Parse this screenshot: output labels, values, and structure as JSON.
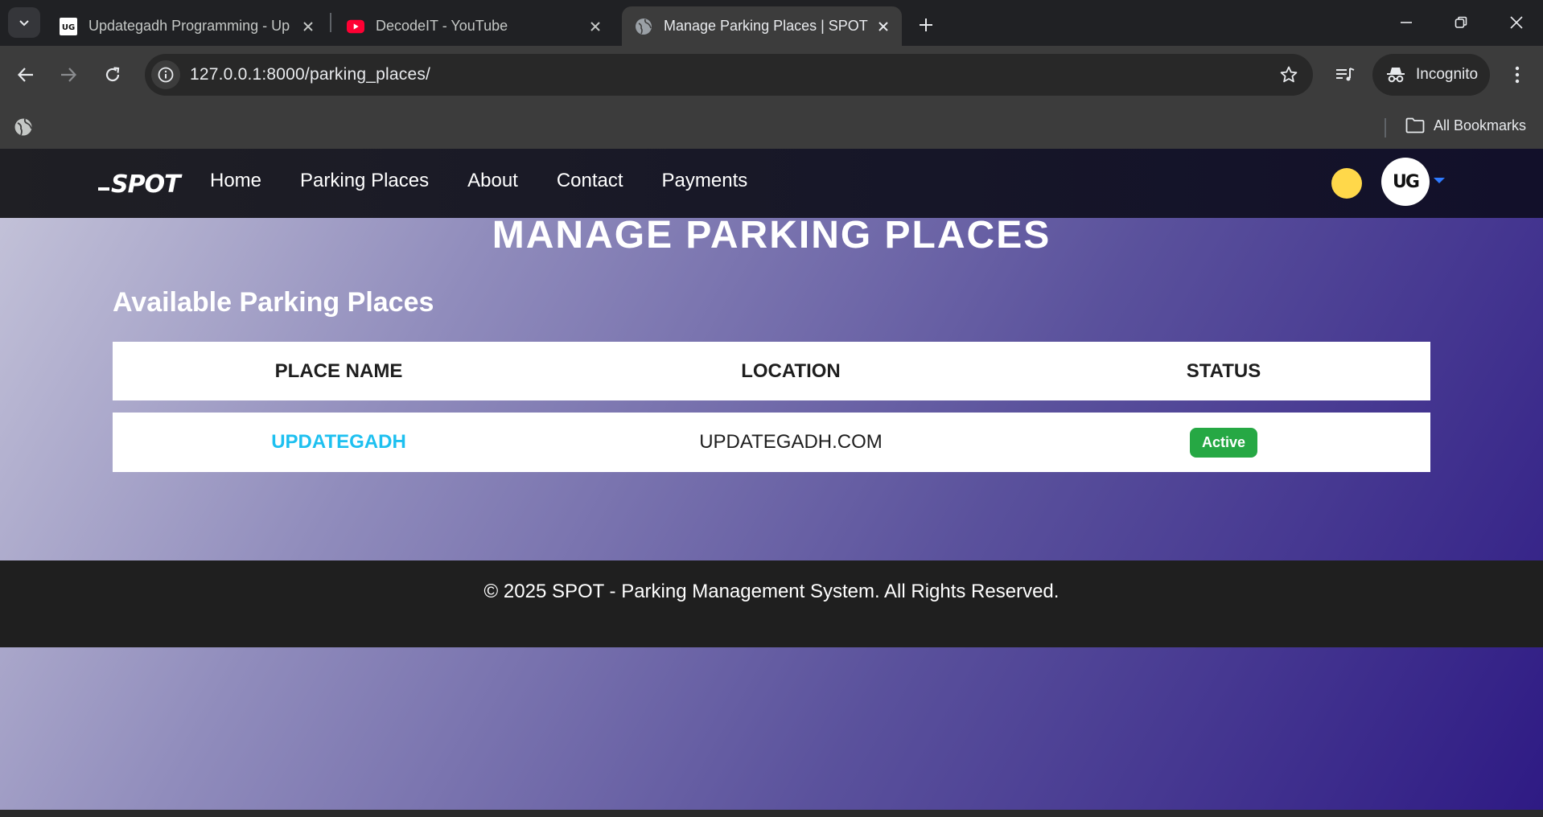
{
  "browser": {
    "tabs": [
      {
        "title": "Updategadh Programming - Up",
        "favicon": "ug-favicon"
      },
      {
        "title": "DecodeIT - YouTube",
        "favicon": "youtube-favicon"
      },
      {
        "title": "Manage Parking Places | SPOT",
        "favicon": "globe-favicon",
        "active": true
      }
    ],
    "url": "127.0.0.1:8000/parking_places/",
    "incognito_label": "Incognito",
    "all_bookmarks_label": "All Bookmarks"
  },
  "site": {
    "logo_text": "SPOT",
    "nav": [
      "Home",
      "Parking Places",
      "About",
      "Contact",
      "Payments"
    ],
    "avatar_text": "UG",
    "accent_color": "#ffd84a"
  },
  "main": {
    "page_title": "MANAGE PARKING PLACES",
    "section_title": "Available Parking Places",
    "table": {
      "headers": [
        "PLACE NAME",
        "LOCATION",
        "STATUS"
      ],
      "rows": [
        {
          "place_name": "UPDATEGADH",
          "location": "UPDATEGADH.COM",
          "status": "Active"
        }
      ]
    }
  },
  "footer": {
    "text": "© 2025 SPOT - Parking Management System. All Rights Reserved."
  },
  "colors": {
    "status_active": "#26a844",
    "link": "#1ec0f0"
  }
}
